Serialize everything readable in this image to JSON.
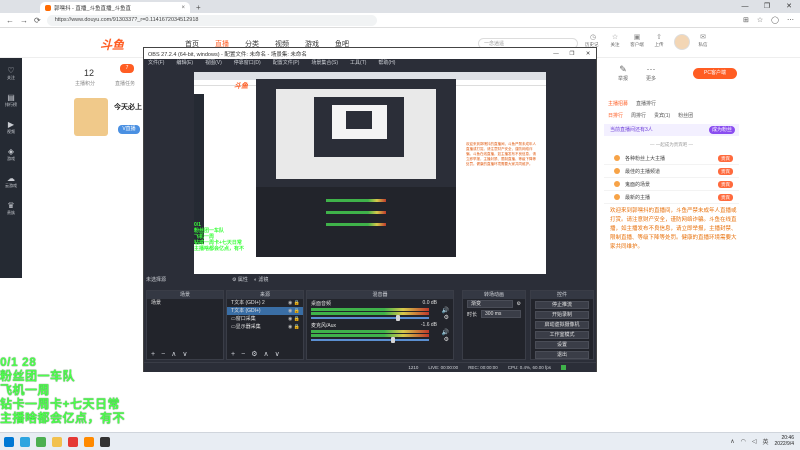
{
  "browser": {
    "tab_title": "郭嘿抖 - 直播_斗鱼直播_斗鱼直",
    "tab_close": "×",
    "new_tab": "+",
    "url": "https://www.douyu.com/9130337?_r=0.1141672034512918",
    "window_controls": [
      "—",
      "❐",
      "✕"
    ],
    "nav": {
      "back": "←",
      "forward": "→",
      "reload": "⟳"
    }
  },
  "site": {
    "logo": "斗鱼",
    "nav": [
      "首页",
      "直播",
      "分类",
      "视频",
      "游戏",
      "鱼吧"
    ],
    "nav_active_index": 1,
    "search_placeholder": "一念逍遥",
    "header_icons": [
      {
        "icon": "history-icon",
        "glyph": "◷",
        "label": "历史记录"
      },
      {
        "icon": "follow-icon",
        "glyph": "☆",
        "label": "关注"
      },
      {
        "icon": "video-icon",
        "glyph": "▣",
        "label": "客户端"
      },
      {
        "icon": "upload-icon",
        "glyph": "⇧",
        "label": "上传"
      },
      {
        "icon": "app-icon",
        "glyph": "◉",
        "label": "鱼吧"
      },
      {
        "icon": "mail-icon",
        "glyph": "✉",
        "label": "私信"
      }
    ],
    "leftbar": [
      {
        "icon": "heart-icon",
        "glyph": "♡",
        "label": "关注"
      },
      {
        "icon": "rank-icon",
        "glyph": "▤",
        "label": "排行榜"
      },
      {
        "icon": "play-icon",
        "glyph": "▶",
        "label": "视频"
      },
      {
        "icon": "game-icon",
        "glyph": "◈",
        "label": "游戏"
      },
      {
        "icon": "cloud-icon",
        "glyph": "☁",
        "label": "云游戏"
      },
      {
        "icon": "vip-icon",
        "glyph": "♛",
        "label": "贵族"
      }
    ],
    "left_panel": {
      "count": "12",
      "count_label": "主播积分",
      "badge": "7",
      "badge_label": "直播任务",
      "promo_title": "今天必上",
      "promo_button": "V直播"
    },
    "right_panel": {
      "top": [
        {
          "icon": "report-icon",
          "glyph": "✎",
          "label": "举报"
        },
        {
          "icon": "more-icon",
          "glyph": "⋯",
          "label": "更多"
        }
      ],
      "pc_button": "PC客户端",
      "tabs_row1": [
        "主播招募",
        "直播排行"
      ],
      "tabs_row2": [
        "日排行",
        "周排行",
        "贵宾(1)",
        "粉丝团"
      ],
      "banner": "当前直播间还有3人",
      "banner_button": "成为粉丝",
      "sub": "— 一起成为贵宾吧 —",
      "rank_items": [
        {
          "name": "各种粉丝上大主播",
          "tag": "贵宾"
        },
        {
          "name": "最佳的主播频道",
          "tag": "贵宾"
        },
        {
          "name": "鬼面的场景",
          "tag": "贵宾"
        },
        {
          "name": "最新的主播",
          "tag": "贵宾"
        }
      ],
      "description": "欢迎来到郭嘿抖的直播间，斗鱼严禁未成年人直播或打赏。请注意财产安全，谨防网络诈骗。斗鱼在线直播，如主播发布不良信息，请立即举报，主播封禁、限制直播、等级下降等处罚。健康的直播环境需要大家共同维护。"
    }
  },
  "obs": {
    "title": "OBS 27.2.4 (64-bit, windows) - 配置文件: 未命名 - 场景集: 未命名",
    "window_controls": [
      "—",
      "❐",
      "✕"
    ],
    "menu": [
      "文件(F)",
      "编辑(E)",
      "视图(V)",
      "停靠窗口(D)",
      "配置文件(P)",
      "场景集合(S)",
      "工具(T)",
      "帮助(H)"
    ],
    "no_source": "未选择源",
    "dock_buttons": [
      "属性",
      "滤镜"
    ],
    "scenes": {
      "title": "场景",
      "items": [
        "场景"
      ]
    },
    "sources": {
      "title": "来源",
      "items": [
        {
          "name": "文本 (GDI+) 2",
          "selected": false
        },
        {
          "name": "文本 (GDI+)",
          "selected": true
        },
        {
          "name": "窗口采集",
          "selected": false
        },
        {
          "name": "显示器采集",
          "selected": false
        }
      ]
    },
    "mixer": {
      "title": "混音器",
      "channels": [
        {
          "name": "桌面音频",
          "db": "0.0 dB",
          "level": 0.72
        },
        {
          "name": "麦克风/Aux",
          "db": "-1.6 dB",
          "level": 0.68
        }
      ]
    },
    "transitions": {
      "title": "转场动画",
      "type": "渐变",
      "duration_label": "时长",
      "duration": "300 ms"
    },
    "controls": {
      "title": "控件",
      "buttons": [
        "停止推流",
        "开始录制",
        "启动虚拟摄像机",
        "工作室模式",
        "设置",
        "退出"
      ]
    },
    "foot_glyphs": [
      "+",
      "−",
      "∧",
      "∨"
    ],
    "foot_glyphs_sources": [
      "+",
      "−",
      "⚙",
      "∧",
      "∨"
    ],
    "status": {
      "live": "LIVE: 00:00:00",
      "rec": "REC: 00:00:00",
      "cpu": "CPU: 0.4%, 60.00 fps",
      "drops": "1210"
    },
    "preview_overlay": [
      "0/1",
      "粉丝团一车队",
      "飞机一周",
      "钻戒一周卡+七天日常",
      "主播啥都会亿点，有不"
    ]
  },
  "overlay": [
    "0/1 28",
    "粉丝团一车队",
    "飞机一周",
    "钻卡一周卡+七天日常",
    "主播啥都会亿点，有不"
  ],
  "taskbar": {
    "time": "20:46",
    "date": "2022/9/4",
    "lang": "英",
    "icons": [
      {
        "name": "start-icon",
        "color": "#0078d4"
      },
      {
        "name": "edge-icon",
        "color": "#2ea5e0"
      },
      {
        "name": "chrome-icon",
        "color": "#4caf50"
      },
      {
        "name": "folder-icon",
        "color": "#f2c14e"
      },
      {
        "name": "app-red-icon",
        "color": "#e53935"
      },
      {
        "name": "app-orange-icon",
        "color": "#ff8a00"
      },
      {
        "name": "obs-icon",
        "color": "#333333"
      }
    ]
  },
  "colors": {
    "accent": "#ff5d23",
    "obs_bg": "#2b2e38",
    "overlay_green": "#4cff4c"
  }
}
